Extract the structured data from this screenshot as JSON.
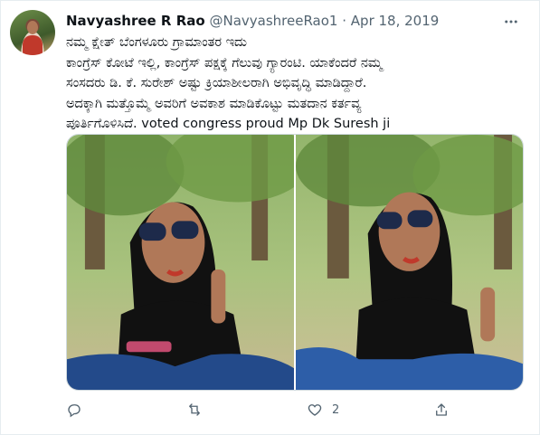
{
  "tweet": {
    "display_name": "Navyashree R Rao",
    "handle": "@NavyashreeRao1",
    "separator": "·",
    "date": "Apr 18, 2019",
    "more_icon": "more-horizontal-icon",
    "text": "ನಮ್ಮ ಕ್ಷೇತ್ ಬೆಂಗಳೂರು ಗ್ರಾಮಾಂತರ ಇದು\nಕಾಂಗ್ರೆಸ್ ಕೋಟೆ ಇಲ್ಲಿ, ಕಾಂಗ್ರೆಸ್ ಪಕ್ಷಕ್ಕೆ ಗೆಲುವು ಗ್ಯಾರಂಟಿ. ಯಾಕೆಂದರೆ ನಮ್ಮ\nಸಂಸದರು ಡಿ. ಕೆ. ಸುರೇಶ್ ಅಷ್ಟು ಕ್ರಿಯಾಶೀಲರಾಗಿ ಅಭಿವೃದ್ಧಿ ಮಾಡಿದ್ದಾರೆ.\nಅದಕ್ಕಾಗಿ ಮತ್ತೊಮ್ಮೆ ಅವರಿಗೆ ಅವಕಾಶ ಮಾಡಿಕೊಟ್ಟು ಮತದಾನ ಕರ್ತವ್ಯ\nಪೂರ್ತಿಗೊಳಿಸಿದೆ. voted congress proud Mp Dk Suresh ji",
    "media": [
      {
        "kind": "photo",
        "description_icon": "photo-left"
      },
      {
        "kind": "photo",
        "description_icon": "photo-right"
      }
    ],
    "actions": {
      "reply": {
        "icon": "reply-icon",
        "count": ""
      },
      "retweet": {
        "icon": "retweet-icon",
        "count": ""
      },
      "like": {
        "icon": "heart-icon",
        "count": "2"
      },
      "share": {
        "icon": "share-icon",
        "count": ""
      }
    }
  },
  "colors": {
    "text_primary": "#0f1419",
    "text_secondary": "#536471",
    "border": "#cfd9de"
  }
}
